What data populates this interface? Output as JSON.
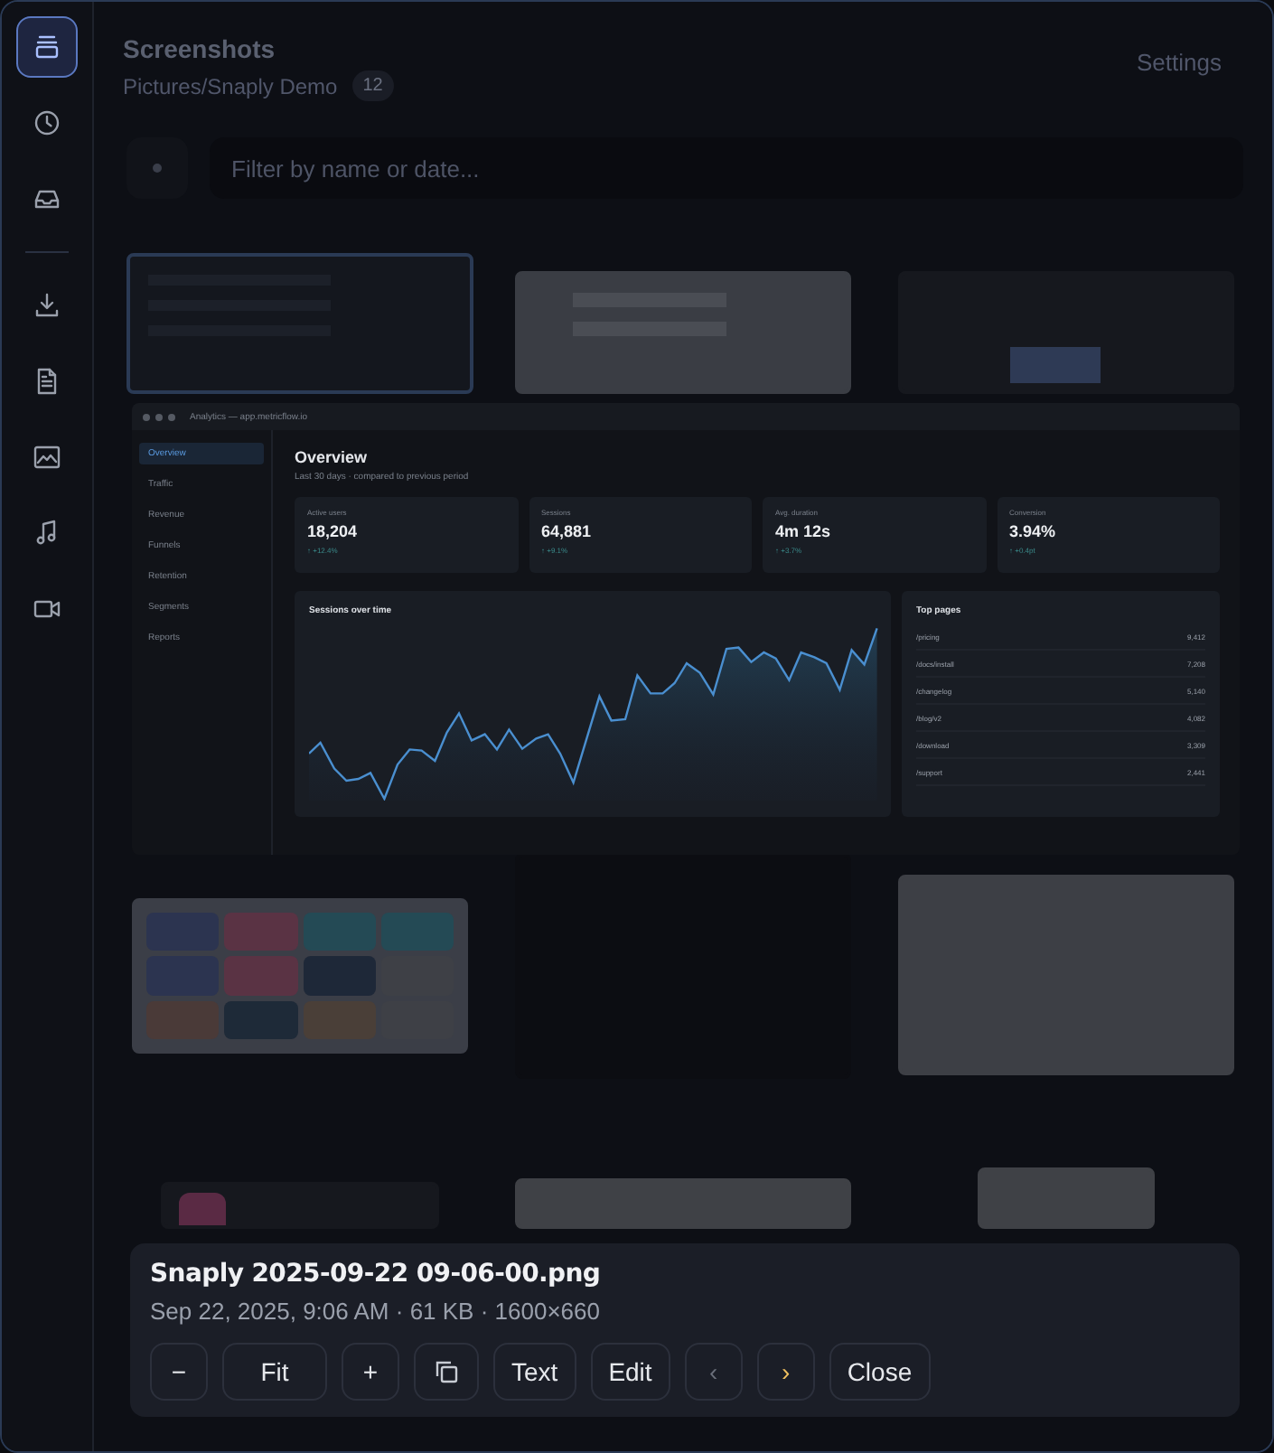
{
  "rail": [
    {
      "selected": true
    },
    {
      "selected": false
    },
    {
      "selected": false
    },
    {
      "selected": false
    },
    {
      "selected": false
    },
    {
      "selected": false
    },
    {
      "selected": false
    },
    {
      "selected": false
    }
  ],
  "header": {
    "title": "Screenshots",
    "path": "Pictures/Snaply Demo",
    "count": "12",
    "settings": "Settings"
  },
  "search": {
    "placeholder": "Filter by name or date..."
  },
  "preview": {
    "window_title": "Analytics — app.metricflow.io",
    "nav": [
      {
        "label": "Overview",
        "selected": true
      },
      {
        "label": "Traffic",
        "selected": false
      },
      {
        "label": "Revenue",
        "selected": false
      },
      {
        "label": "Funnels",
        "selected": false
      },
      {
        "label": "Retention",
        "selected": false
      },
      {
        "label": "Segments",
        "selected": false
      },
      {
        "label": "Reports",
        "selected": false
      }
    ],
    "heading": "Overview",
    "subheading": "Last 30 days · compared to previous period",
    "stats": [
      {
        "label": "Active users",
        "value": "18,204",
        "change": "↑ +12.4%"
      },
      {
        "label": "Sessions",
        "value": "64,881",
        "change": "↑ +9.1%"
      },
      {
        "label": "Avg. duration",
        "value": "4m 12s",
        "change": "↑ +3.7%"
      },
      {
        "label": "Conversion",
        "value": "3.94%",
        "change": "↑ +0.4pt"
      }
    ],
    "chart_title": "Sessions over time",
    "top_pages": {
      "title": "Top pages",
      "rows": [
        {
          "path": "/pricing",
          "count": "9,412"
        },
        {
          "path": "/docs/install",
          "count": "7,208"
        },
        {
          "path": "/changelog",
          "count": "5,140"
        },
        {
          "path": "/blog/v2",
          "count": "4,082"
        },
        {
          "path": "/download",
          "count": "3,309"
        },
        {
          "path": "/support",
          "count": "2,441"
        }
      ]
    }
  },
  "info": {
    "file_name": "Snaply 2025-09-22 09-06-00.png",
    "meta": "Sep 22, 2025, 9:06 AM · 61 KB · 1600×660",
    "buttons": [
      {
        "kind": "text",
        "label": "−",
        "disabled": false,
        "focused": false
      },
      {
        "kind": "text",
        "label": "Fit",
        "disabled": false,
        "focused": false
      },
      {
        "kind": "text",
        "label": "+",
        "disabled": false,
        "focused": false
      },
      {
        "kind": "icon",
        "disabled": false,
        "focused": false
      },
      {
        "kind": "text",
        "label": "Text",
        "disabled": false,
        "focused": false
      },
      {
        "kind": "text",
        "label": "Edit",
        "disabled": false,
        "focused": false
      },
      {
        "kind": "text",
        "label": "‹",
        "disabled": true,
        "focused": false
      },
      {
        "kind": "text",
        "label": "›",
        "disabled": false,
        "focused": true
      },
      {
        "kind": "text",
        "label": "Close",
        "disabled": false,
        "focused": false
      }
    ]
  }
}
